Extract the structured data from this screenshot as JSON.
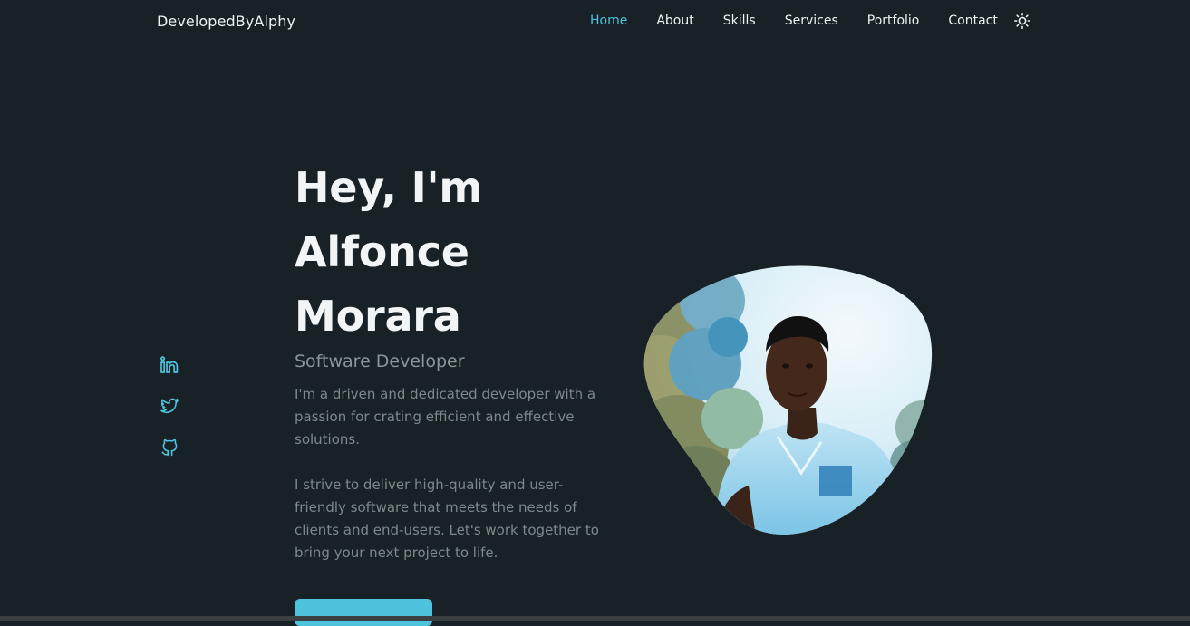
{
  "header": {
    "logo": "DevelopedByAlphy",
    "nav": [
      {
        "label": "Home",
        "active": true
      },
      {
        "label": "About",
        "active": false
      },
      {
        "label": "Skills",
        "active": false
      },
      {
        "label": "Services",
        "active": false
      },
      {
        "label": "Portfolio",
        "active": false
      },
      {
        "label": "Contact",
        "active": false
      }
    ],
    "theme_icon": "sun-icon"
  },
  "social": [
    {
      "icon": "linkedin-icon"
    },
    {
      "icon": "twitter-icon"
    },
    {
      "icon": "github-icon"
    }
  ],
  "hero": {
    "title_lines": [
      "Hey, I'm",
      "Alfonce",
      "Morara"
    ],
    "subtitle": "Software Developer",
    "paragraph_1": "I'm a driven and dedicated developer with a passion for crating efficient and effective solutions.",
    "paragraph_2": "I strive to deliver high-quality and user-friendly software that meets the needs of clients and end-users. Let's work together to bring your next project to life."
  },
  "colors": {
    "background": "#182125",
    "accent": "#4ec3de",
    "text": "#f2f5f6",
    "muted": "#7d888c"
  }
}
